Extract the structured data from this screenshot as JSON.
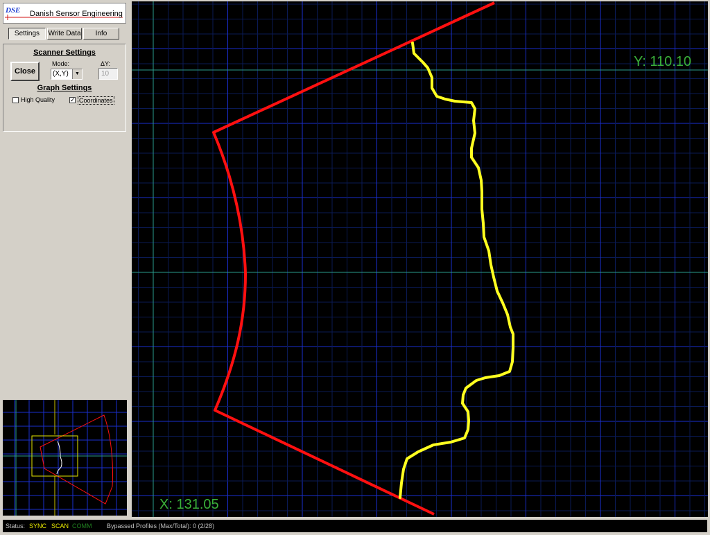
{
  "app": {
    "company": "Danish Sensor Engineering",
    "logo_text": "DSE"
  },
  "tabs": [
    {
      "label": "Settings",
      "active": true
    },
    {
      "label": "Write Data",
      "active": false
    },
    {
      "label": "Info",
      "active": false
    }
  ],
  "scanner_settings": {
    "title": "Scanner Settings",
    "close_label": "Close",
    "mode_label": "Mode:",
    "mode_value": "(X,Y)",
    "delta_y_label": "ΔY:",
    "delta_y_value": "10"
  },
  "graph_settings": {
    "title": "Graph Settings",
    "high_quality_label": "High Quality",
    "high_quality_checked": false,
    "coordinates_label": "Coordinates",
    "coordinates_checked": true
  },
  "readouts": {
    "y": "Y: 110.10",
    "x": "X: 131.05"
  },
  "status": {
    "label": "Status:",
    "sync": "SYNC",
    "scan": "SCAN",
    "comm": "COMM",
    "bypassed": "Bypassed Profiles (Max/Total): 0 (2/28)"
  },
  "colors": {
    "grid_minor": "#0a1a55",
    "grid_major": "#1a2fd0",
    "crosshair": "#2a9c8c",
    "boundary": "#ff1010",
    "profile": "#ffff20",
    "readout": "#3ab03a",
    "status_sync": "#e8e800",
    "status_comm": "#208020"
  }
}
